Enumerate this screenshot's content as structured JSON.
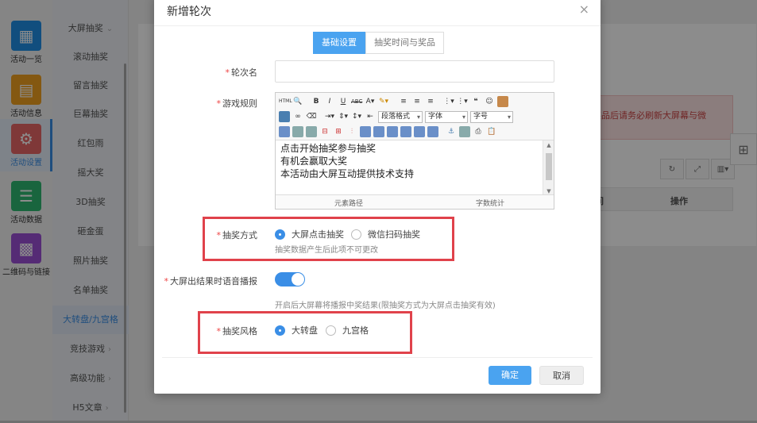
{
  "sidebar": {
    "items": [
      {
        "label": "活动一览",
        "icon": "grid-icon",
        "color": "#1f8fe6"
      },
      {
        "label": "活动信息",
        "icon": "document-icon",
        "color": "#f0a020"
      },
      {
        "label": "活动设置",
        "icon": "gear-icon",
        "color": "#e86666"
      },
      {
        "label": "活动数据",
        "icon": "database-icon",
        "color": "#2eb872"
      },
      {
        "label": "二维码与链接",
        "icon": "qrcode-icon",
        "color": "#9b4fd6"
      }
    ]
  },
  "submenu": {
    "items": [
      "大屏抽奖",
      "滚动抽奖",
      "留言抽奖",
      "巨幕抽奖",
      "红包雨",
      "摇大奖",
      "3D抽奖",
      "砸金蛋",
      "照片抽奖",
      "名单抽奖",
      "大转盘/九宫格",
      "竞技游戏",
      "高级功能",
      "H5文章"
    ]
  },
  "page": {
    "warning_text": "或者奖品后请务必刷新大屏幕与微",
    "col_time": "时间",
    "col_action": "操作"
  },
  "modal": {
    "title": "新增轮次",
    "close": "×",
    "tabs": [
      "基础设置",
      "抽奖时间与奖品"
    ],
    "round_name_label": "轮次名",
    "rules_label": "游戏规则",
    "rules_lines": [
      "点击开始抽奖参与抽奖",
      "有机会赢取大奖",
      "本活动由大屏互动提供技术支持"
    ],
    "editor": {
      "para_format": "段落格式",
      "font": "字体",
      "font_size": "字号",
      "path_label": "元素路径",
      "word_count": "字数统计"
    },
    "mode_label": "抽奖方式",
    "mode_options": [
      "大屏点击抽奖",
      "微信扫码抽奖"
    ],
    "mode_hint": "抽奖数据产生后此项不可更改",
    "voice_label": "大屏出结果时语音播报",
    "voice_hint": "开启后大屏幕将播报中奖结果(限抽奖方式为大屏点击抽奖有效)",
    "style_label": "抽奖风格",
    "style_options": [
      "大转盘",
      "九宫格"
    ],
    "ok": "确定",
    "cancel": "取消"
  }
}
